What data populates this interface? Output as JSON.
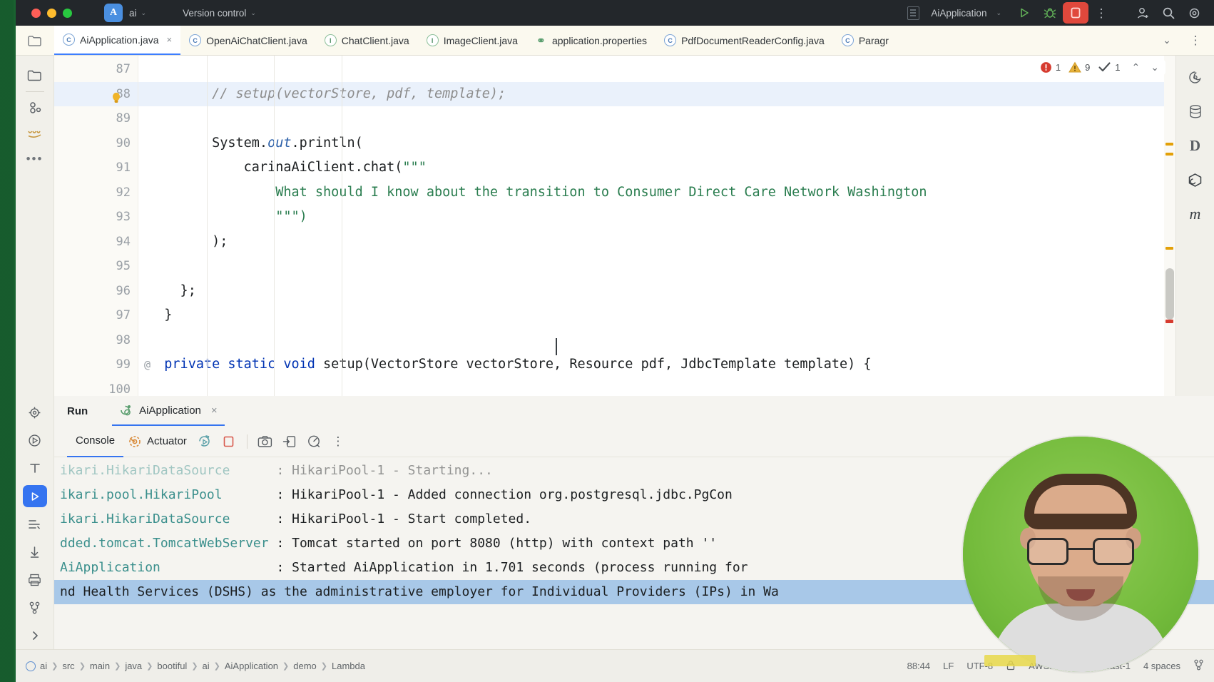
{
  "window": {
    "project_name": "ai",
    "project_initial": "A",
    "vcs_label": "Version control",
    "run_config": "AiApplication",
    "chevron": "⌄"
  },
  "titlebar_icons": {
    "run": "run-icon",
    "debug": "debug-icon",
    "stop": "stop-icon",
    "more": "⋮",
    "account": "account-icon",
    "search": "search-icon",
    "settings": "settings-icon"
  },
  "tabs": [
    {
      "label": "AiApplication.java",
      "icon": "java-class-icon",
      "active": true,
      "closable": true
    },
    {
      "label": "OpenAiChatClient.java",
      "icon": "java-class-icon",
      "active": false,
      "closable": false
    },
    {
      "label": "ChatClient.java",
      "icon": "java-interface-icon",
      "active": false,
      "closable": false
    },
    {
      "label": "ImageClient.java",
      "icon": "java-interface-icon",
      "active": false,
      "closable": false
    },
    {
      "label": "application.properties",
      "icon": "spring-properties-icon",
      "active": false,
      "closable": false
    },
    {
      "label": "PdfDocumentReaderConfig.java",
      "icon": "java-class-icon",
      "active": false,
      "closable": false
    },
    {
      "label": "Paragr",
      "icon": "java-class-icon",
      "active": false,
      "closable": false
    }
  ],
  "tabbar_right": {
    "chevron": "⌄",
    "kebab": "⋮",
    "notifications": "bell-icon"
  },
  "left_sidebar": [
    {
      "name": "project-tool-window",
      "icon": "folder-icon"
    },
    {
      "name": "commit-tool-window",
      "icon": "commit-icon"
    },
    {
      "name": "aws-tool-window",
      "icon": "aws-icon"
    },
    {
      "name": "more-tool-windows",
      "icon": "ellipsis-icon",
      "glyph": "•••"
    }
  ],
  "right_sidebar": [
    {
      "name": "ai-assistant",
      "icon": "ai-assistant-icon"
    },
    {
      "name": "database",
      "icon": "database-icon"
    },
    {
      "name": "docker",
      "icon": "docker-d-icon",
      "glyph": "D"
    },
    {
      "name": "maven",
      "icon": "maven-icon"
    },
    {
      "name": "maven-m",
      "icon": "maven-m-icon",
      "glyph": "m"
    }
  ],
  "inspection_widget": {
    "errors": "1",
    "warnings": "9",
    "checks": "1",
    "prev": "⌃",
    "next": "⌄"
  },
  "editor": {
    "first_line": 87,
    "highlight_line": 88,
    "caret_position": "88:44",
    "lines": [
      {
        "num": "87",
        "segments": []
      },
      {
        "num": "88",
        "lamp": true,
        "highlight": true,
        "segments": [
          {
            "t": "        // setup(vectorStore, pdf, template);",
            "c": "cmt"
          }
        ]
      },
      {
        "num": "89",
        "segments": []
      },
      {
        "num": "90",
        "segments": [
          {
            "t": "        System.",
            "c": "plain"
          },
          {
            "t": "out",
            "c": "fld"
          },
          {
            "t": ".println(",
            "c": "plain"
          }
        ]
      },
      {
        "num": "91",
        "segments": [
          {
            "t": "            carinaAiClient.chat(",
            "c": "plain"
          },
          {
            "t": "\"\"\"",
            "c": "str"
          }
        ]
      },
      {
        "num": "92",
        "segments": [
          {
            "t": "                What should I know about the transition to Consumer Direct Care Network Washington",
            "c": "str"
          }
        ]
      },
      {
        "num": "93",
        "segments": [
          {
            "t": "                \"\"\")",
            "c": "str"
          }
        ]
      },
      {
        "num": "94",
        "segments": [
          {
            "t": "        );",
            "c": "plain"
          }
        ]
      },
      {
        "num": "95",
        "segments": []
      },
      {
        "num": "96",
        "segments": [
          {
            "t": "    };",
            "c": "plain"
          }
        ]
      },
      {
        "num": "97",
        "segments": [
          {
            "t": "  }",
            "c": "plain"
          }
        ]
      },
      {
        "num": "98",
        "segments": []
      },
      {
        "num": "99",
        "fold": "@",
        "segments": [
          {
            "t": "  ",
            "c": "plain"
          },
          {
            "t": "private static void ",
            "c": "kw"
          },
          {
            "t": "setup(VectorStore vectorStore, Resource pdf, JdbcTemplate template) {",
            "c": "plain"
          }
        ]
      },
      {
        "num": "100",
        "segments": []
      }
    ]
  },
  "run_panel": {
    "title": "Run",
    "tab": {
      "label": "AiApplication",
      "icon": "spring-boot-icon",
      "close": "×"
    },
    "console_tabs": [
      {
        "label": "Console",
        "active": true
      },
      {
        "label": "Actuator",
        "icon": "actuator-icon",
        "active": false
      }
    ],
    "toolbar": [
      {
        "name": "rerun-button",
        "icon": "rerun-icon"
      },
      {
        "name": "stop-button",
        "icon": "stop-square-icon"
      },
      {
        "name": "screenshot-button",
        "icon": "camera-icon"
      },
      {
        "name": "open-in-browser-button",
        "icon": "export-icon"
      },
      {
        "name": "profiler-button",
        "icon": "gauge-icon"
      },
      {
        "name": "more-options-button",
        "icon": "kebab-icon",
        "glyph": "⋮"
      }
    ],
    "left_rail": [
      {
        "name": "settings",
        "icon": "gear-icon"
      },
      {
        "name": "services",
        "icon": "services-icon"
      },
      {
        "name": "terminal-t",
        "icon": "letter-t-icon"
      },
      {
        "name": "run-active",
        "icon": "run-triangle-icon",
        "active": true
      },
      {
        "name": "build",
        "icon": "build-icon"
      },
      {
        "name": "debug-down",
        "icon": "arrow-down-icon"
      },
      {
        "name": "print",
        "icon": "printer-icon"
      },
      {
        "name": "git",
        "icon": "git-branch-icon"
      },
      {
        "name": "expand",
        "icon": "chevron-right-icon"
      }
    ],
    "output_lines": [
      {
        "logger": "ikari.HikariDataSource",
        "message": ": HikariPool-1 - Starting...",
        "dim": true
      },
      {
        "logger": "ikari.pool.HikariPool",
        "message": ": HikariPool-1 - Added connection org.postgresql.jdbc.PgCon"
      },
      {
        "logger": "ikari.HikariDataSource",
        "message": ": HikariPool-1 - Start completed."
      },
      {
        "logger": "dded.tomcat.TomcatWebServer",
        "message": ": Tomcat started on port 8080 (http) with context path ''"
      },
      {
        "logger": "AiApplication",
        "message": ": Started AiApplication in 1.701 seconds (process running for"
      },
      {
        "logger": "",
        "message": "nd Health Services (DSHS) as the administrative employer for Individual Providers (IPs) in Wa",
        "selected": true
      }
    ]
  },
  "status_bar": {
    "breadcrumbs": [
      "ai",
      "src",
      "main",
      "java",
      "bootiful",
      "ai",
      "AiApplication",
      "demo",
      "Lambda"
    ],
    "caret": "88:44",
    "line_separator": "LF",
    "encoding": "UTF-8",
    "read_only": "lock-icon",
    "aws_profile": "AWS: default@us-east-1",
    "indent": "4 spaces",
    "branch_icon": "git-branch-icon"
  },
  "colors": {
    "accent_blue": "#3574f0",
    "error_red": "#e0483c",
    "warning_yellow": "#e3a008",
    "string_green": "#2a7d4f",
    "keyword_blue": "#0033b3",
    "webcam_green": "#74bb3c"
  }
}
